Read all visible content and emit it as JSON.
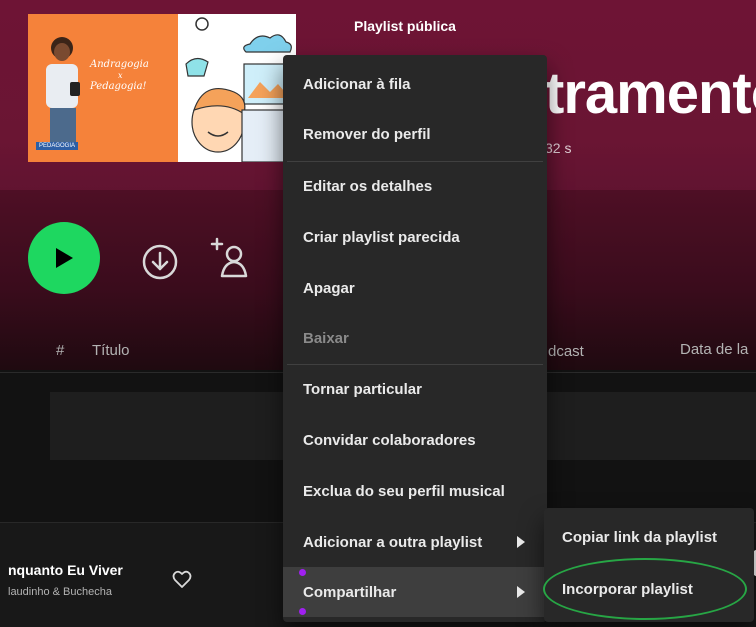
{
  "header": {
    "playlist_type": "Playlist pública",
    "title_fragment": "tramento",
    "meta_fragment": "32 s",
    "accent_color": "#6e1435"
  },
  "cover": {
    "line1": "Andragogia",
    "line2": "x",
    "line3": "Pedagogia!",
    "logo_text": "PEDAGOGIA"
  },
  "controls": {
    "play_icon": "play-icon",
    "download_icon": "download-circle-icon",
    "follow_icon": "add-user-icon",
    "play_color": "#1ed760"
  },
  "table_header": {
    "hash": "#",
    "title": "Título",
    "podcast_fragment": "dcast",
    "date_fragment": "Data de la"
  },
  "context_menu": {
    "items": [
      {
        "label": "Adicionar à fila"
      },
      {
        "label": "Remover do perfil"
      },
      {
        "label": "Editar os detalhes"
      },
      {
        "label": "Criar playlist parecida"
      },
      {
        "label": "Apagar"
      },
      {
        "label": "Baixar"
      },
      {
        "label": "Tornar particular"
      },
      {
        "label": "Convidar colaboradores"
      },
      {
        "label": "Exclua do seu perfil musical"
      },
      {
        "label": "Adicionar a outra playlist"
      },
      {
        "label": "Compartilhar"
      }
    ]
  },
  "share_submenu": {
    "items": [
      {
        "label": "Copiar link da playlist"
      },
      {
        "label": "Incorporar playlist"
      }
    ],
    "highlight_color": "#27a645"
  },
  "now_playing": {
    "title": "nquanto Eu Viver",
    "artist": "laudinho & Buchecha",
    "heart_icon": "heart-outline-icon"
  }
}
